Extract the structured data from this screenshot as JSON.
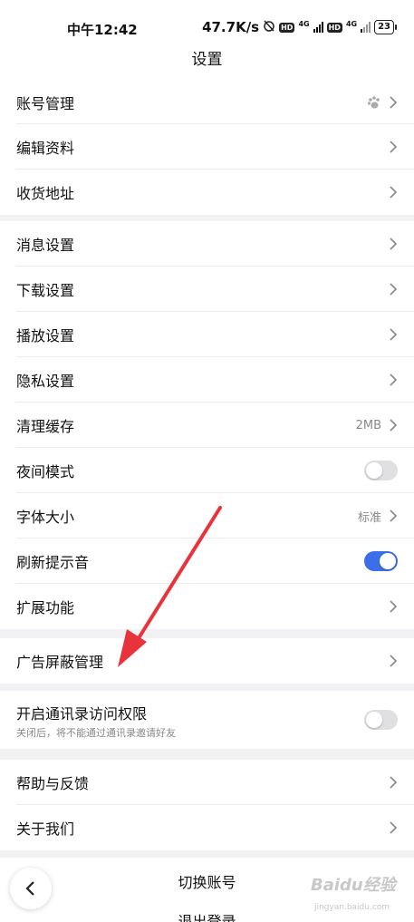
{
  "status": {
    "time": "中午12:42",
    "speed": "47.7K/s",
    "hd1": "HD",
    "net1": "4G",
    "hd2": "HD",
    "net2": "4G",
    "battery": "23"
  },
  "header": {
    "title": "设置"
  },
  "sections": {
    "account": {
      "label": "账号管理"
    },
    "edit_profile": {
      "label": "编辑资料"
    },
    "address": {
      "label": "收货地址"
    },
    "message": {
      "label": "消息设置"
    },
    "download": {
      "label": "下载设置"
    },
    "playback": {
      "label": "播放设置"
    },
    "privacy": {
      "label": "隐私设置"
    },
    "cache": {
      "label": "清理缓存",
      "value": "2MB"
    },
    "night": {
      "label": "夜间模式",
      "on": false
    },
    "font": {
      "label": "字体大小",
      "value": "标准"
    },
    "refresh_sound": {
      "label": "刷新提示音",
      "on": true
    },
    "extensions": {
      "label": "扩展功能"
    },
    "ad_block": {
      "label": "广告屏蔽管理"
    },
    "contacts": {
      "label": "开启通讯录访问权限",
      "sub": "关闭后，将不能通过通讯录邀请好友",
      "on": false
    },
    "help": {
      "label": "帮助与反馈"
    },
    "about": {
      "label": "关于我们"
    }
  },
  "bottom": {
    "switch_account": "切换账号",
    "next_label": "退出登录"
  },
  "watermark": {
    "text": "Baidu经验",
    "url": "jingyan.baidu.com"
  },
  "colors": {
    "accent": "#3b6ee8",
    "annotation_arrow": "#e8323c"
  }
}
